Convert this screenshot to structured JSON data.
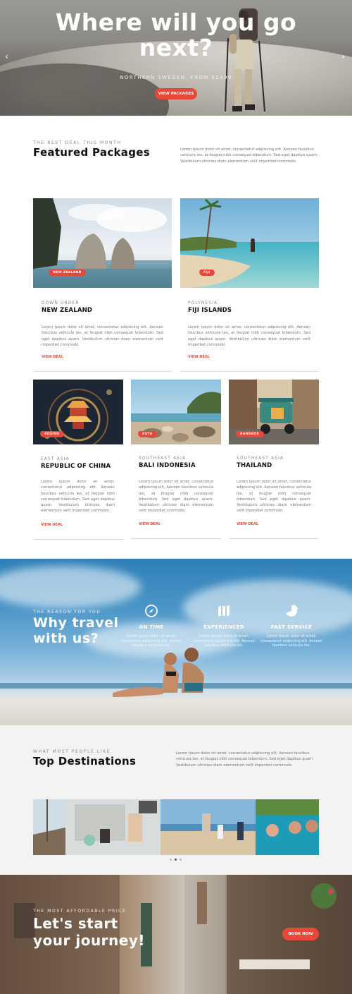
{
  "hero": {
    "title_line1": "Where will you go",
    "title_line2": "next?",
    "subtitle": "NORTHERN SWEDEN, FROM $1499",
    "cta": "VIEW PACKAGES",
    "prev_icon": "chevron-left-icon",
    "next_icon": "chevron-right-icon"
  },
  "featured": {
    "kicker": "THE BEST DEAL THIS MONTH",
    "title": "Featured Packages",
    "intro": "Lorem ipsum dolor sit amet, consectetur adipiscing elit. Aenean faucibus vehicula leo, at feugiat nibh consequat bibendum. Sed eget dapibus quam. Vestibulum ultricies diam elementum velit imperdiet commodo."
  },
  "packages": [
    {
      "tag": "NEW ZEALAND",
      "category": "DOWN UNDER",
      "title": "NEW ZEALAND",
      "desc": "Lorem ipsum dolor sit amet, consectetur adipiscing elit. Aenean faucibus vehicula leo, at feugiat nibh consequat bibendum. Sed eget dapibus quam. Vestibulum ultricies diam elementum velit imperdiet commodo.",
      "deal": "VIEW DEAL"
    },
    {
      "tag": "FIJI",
      "category": "POLYNESIA",
      "title": "FIJI ISLANDS",
      "desc": "Lorem ipsum dolor sit amet, consectetur adipiscing elit. Aenean faucibus vehicula leo, at feugiat nibh consequat bibendum. Sed eget dapibus quam. Vestibulum ultricies diam elementum velit imperdiet commodo.",
      "deal": "VIEW DEAL"
    },
    {
      "tag": "BEIJING",
      "category": "EAST ASIA",
      "title": "REPUBLIC OF CHINA",
      "desc": "Lorem ipsum dolor sit amet, consectetur adipiscing elit. Aenean faucibus vehicula leo, at feugiat nibh consequat bibendum. Sed eget dapibus quam. Vestibulum ultricies diam elementum velit imperdiet commodo.",
      "deal": "VIEW DEAL"
    },
    {
      "tag": "KUTA",
      "category": "SOUTHEAST ASIA",
      "title": "BALI INDONESIA",
      "desc": "Lorem ipsum dolor sit amet, consectetur adipiscing elit. Aenean faucibus vehicula leo, at feugiat nibh consequat bibendum. Sed eget dapibus quam. Vestibulum ultricies diam elementum velit imperdiet commodo.",
      "deal": "VIEW DEAL"
    },
    {
      "tag": "BANGKOK",
      "category": "SOUTHEAST ASIA",
      "title": "THAILAND",
      "desc": "Lorem ipsum dolor sit amet, consectetur adipiscing elit. Aenean faucibus vehicula leo, at feugiat nibh consequat bibendum. Sed eget dapibus quam. Vestibulum ultricies diam elementum velit imperdiet commodo.",
      "deal": "VIEW DEAL"
    }
  ],
  "why": {
    "kicker": "THE REASON FOR YOU",
    "title_line1": "Why travel",
    "title_line2": "with us?",
    "features": [
      {
        "icon": "compass-icon",
        "title": "ON TIME",
        "desc": "Lorem ipsum dolor sit amet, consectetur adipiscing elit. Aenean faucibus vehicula leo."
      },
      {
        "icon": "map-icon",
        "title": "EXPERIENCED",
        "desc": "Lorem ipsum dolor sit amet, consectetur adipiscing elit. Aenean faucibus vehicula leo."
      },
      {
        "icon": "pie-chart-icon",
        "title": "FAST SERVICE",
        "desc": "Lorem ipsum dolor sit amet, consectetur adipiscing elit. Aenean faucibus vehicula leo."
      }
    ]
  },
  "destinations": {
    "kicker": "WHAT MOST PEOPLE LIKE",
    "title": "Top Destinations",
    "intro": "Lorem ipsum dolor sit amet, consectetur adipiscing elit. Aenean faucibus vehicula leo, at feugiat nibh consequat bibendum. Sed eget dapibus quam. Vestibulum ultricies diam elementum velit imperdiet commodo."
  },
  "journey": {
    "kicker": "THE MOST AFFORDABLE PRICE",
    "title_line1": "Let's start",
    "title_line2": "your journey!",
    "cta": "BOOK NOW"
  },
  "colors": {
    "accent": "#e8483a",
    "sky": "#4b96c8"
  }
}
